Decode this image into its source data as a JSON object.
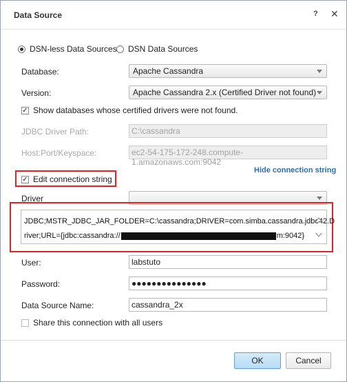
{
  "title": "Data Source",
  "titlebar": {
    "help": "?",
    "close": "✕"
  },
  "source_type": {
    "option_dsnless": "DSN-less Data Sources",
    "option_dsn": "DSN Data Sources",
    "selected": "DSN-less Data Sources"
  },
  "database": {
    "label": "Database:",
    "value": "Apache Cassandra"
  },
  "version": {
    "label": "Version:",
    "value": "Apache Cassandra 2.x (Certified Driver not found)"
  },
  "show_uncertified": {
    "label": "Show databases whose certified drivers were not found.",
    "checked": true
  },
  "jdbc_driver_path": {
    "label": "JDBC Driver Path:",
    "value": "C:\\cassandra"
  },
  "host_port_keyspace": {
    "label": "Host:Port/Keyspace:",
    "value": "ec2-54-175-172-248.compute-1.amazonaws.com:9042"
  },
  "hide_connection_link": "Hide connection string",
  "edit_connection": {
    "label": "Edit connection string",
    "checked": true
  },
  "driver": {
    "label": "Driver",
    "value": ""
  },
  "connection_string": {
    "line1": "JDBC;MSTR_JDBC_JAR_FOLDER=C:\\cassandra;DRIVER=com.simba.cassandra.jdbc42.D",
    "line2_prefix": "river;URL={jdbc:cassandra://",
    "line2_suffix": "m:9042}"
  },
  "user": {
    "label": "User:",
    "value": "labstuto"
  },
  "password": {
    "label": "Password:",
    "value": "●●●●●●●●●●●●●●●"
  },
  "data_source_name": {
    "label": "Data Source Name:",
    "value": "cassandra_2x"
  },
  "share": {
    "label": "Share this connection with all users",
    "checked": false
  },
  "buttons": {
    "ok": "OK",
    "cancel": "Cancel"
  },
  "colors": {
    "link": "#2a6fb0",
    "highlight_box": "#e02424",
    "ok_button": "#b9dcf5"
  }
}
